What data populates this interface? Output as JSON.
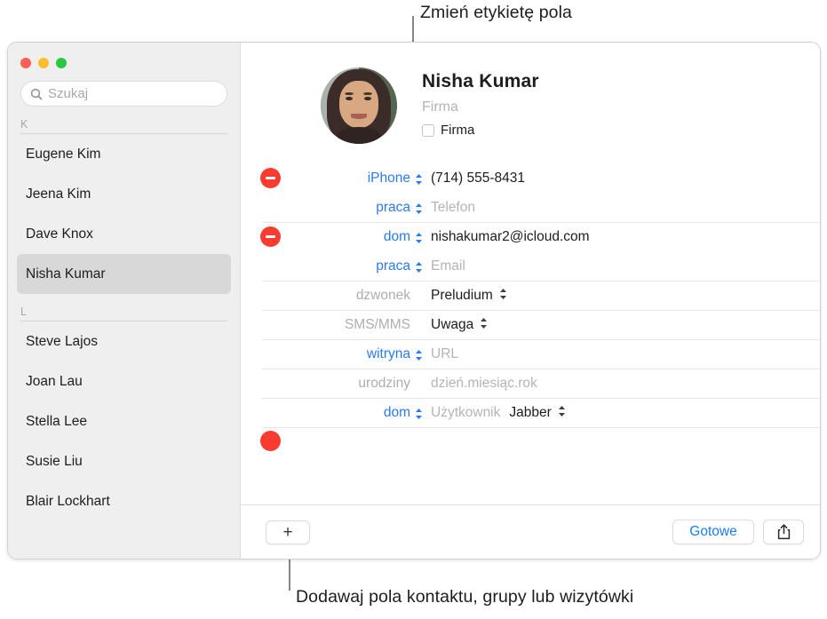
{
  "callouts": {
    "top": "Zmień etykietę pola",
    "bottom": "Dodawaj pola kontaktu, grupy lub wizytówki"
  },
  "window": {
    "traffic_lights": {
      "close_color": "#ff5f57",
      "minimize_color": "#febc2e",
      "zoom_color": "#28c840"
    }
  },
  "sidebar": {
    "search": {
      "placeholder": "Szukaj",
      "value": "",
      "icon": "search-icon"
    },
    "groups": [
      {
        "header": "K",
        "contacts": [
          {
            "name": "Eugene Kim",
            "selected": false
          },
          {
            "name": "Jeena Kim",
            "selected": false
          },
          {
            "name": "Dave Knox",
            "selected": false
          },
          {
            "name": "Nisha Kumar",
            "selected": true
          }
        ]
      },
      {
        "header": "L",
        "contacts": [
          {
            "name": "Steve Lajos",
            "selected": false
          },
          {
            "name": "Joan Lau",
            "selected": false
          },
          {
            "name": "Stella Lee",
            "selected": false
          },
          {
            "name": "Susie Liu",
            "selected": false
          },
          {
            "name": "Blair Lockhart",
            "selected": false
          }
        ]
      }
    ]
  },
  "detail": {
    "name": "Nisha  Kumar",
    "company_placeholder": "Firma",
    "company_checkbox_label": "Firma",
    "fields": [
      {
        "label": "iPhone",
        "label_style": "blue",
        "has_stepper": true,
        "value": "(714) 555-8431",
        "is_placeholder": false,
        "removable": true,
        "divider": false
      },
      {
        "label": "praca",
        "label_style": "blue",
        "has_stepper": true,
        "value": "Telefon",
        "is_placeholder": true,
        "removable": false,
        "divider": false
      },
      {
        "label": "dom",
        "label_style": "blue",
        "has_stepper": true,
        "value": "nishakumar2@icloud.com",
        "is_placeholder": false,
        "removable": true,
        "divider": true
      },
      {
        "label": "praca",
        "label_style": "blue",
        "has_stepper": true,
        "value": "Email",
        "is_placeholder": true,
        "removable": false,
        "divider": false
      },
      {
        "label": "dzwonek",
        "label_style": "gray",
        "has_stepper": false,
        "value": "Preludium",
        "is_placeholder": false,
        "removable": false,
        "divider": true,
        "value_stepper": true
      },
      {
        "label": "SMS/MMS",
        "label_style": "gray",
        "has_stepper": false,
        "value": "Uwaga",
        "is_placeholder": false,
        "removable": false,
        "divider": true,
        "value_stepper": true
      },
      {
        "label": "witryna",
        "label_style": "blue",
        "has_stepper": true,
        "value": "URL",
        "is_placeholder": true,
        "removable": false,
        "divider": true
      },
      {
        "label": "urodziny",
        "label_style": "gray",
        "has_stepper": false,
        "value": "dzień.miesiąc.rok",
        "is_placeholder": true,
        "removable": false,
        "divider": true
      },
      {
        "label": "dom",
        "label_style": "blue",
        "has_stepper": true,
        "value": "Użytkownik",
        "is_placeholder": true,
        "removable": false,
        "divider": true,
        "extra_value": "Jabber",
        "extra_stepper": true
      }
    ]
  },
  "toolbar": {
    "add_label": "+",
    "done_label": "Gotowe",
    "share_icon": "share-icon"
  },
  "colors": {
    "accent_blue": "#1a7cf7",
    "label_blue": "#2a7bf0",
    "remove_red": "#fc3b30",
    "sidebar_bg": "#efefef",
    "selected_row": "#d8d8d8"
  }
}
